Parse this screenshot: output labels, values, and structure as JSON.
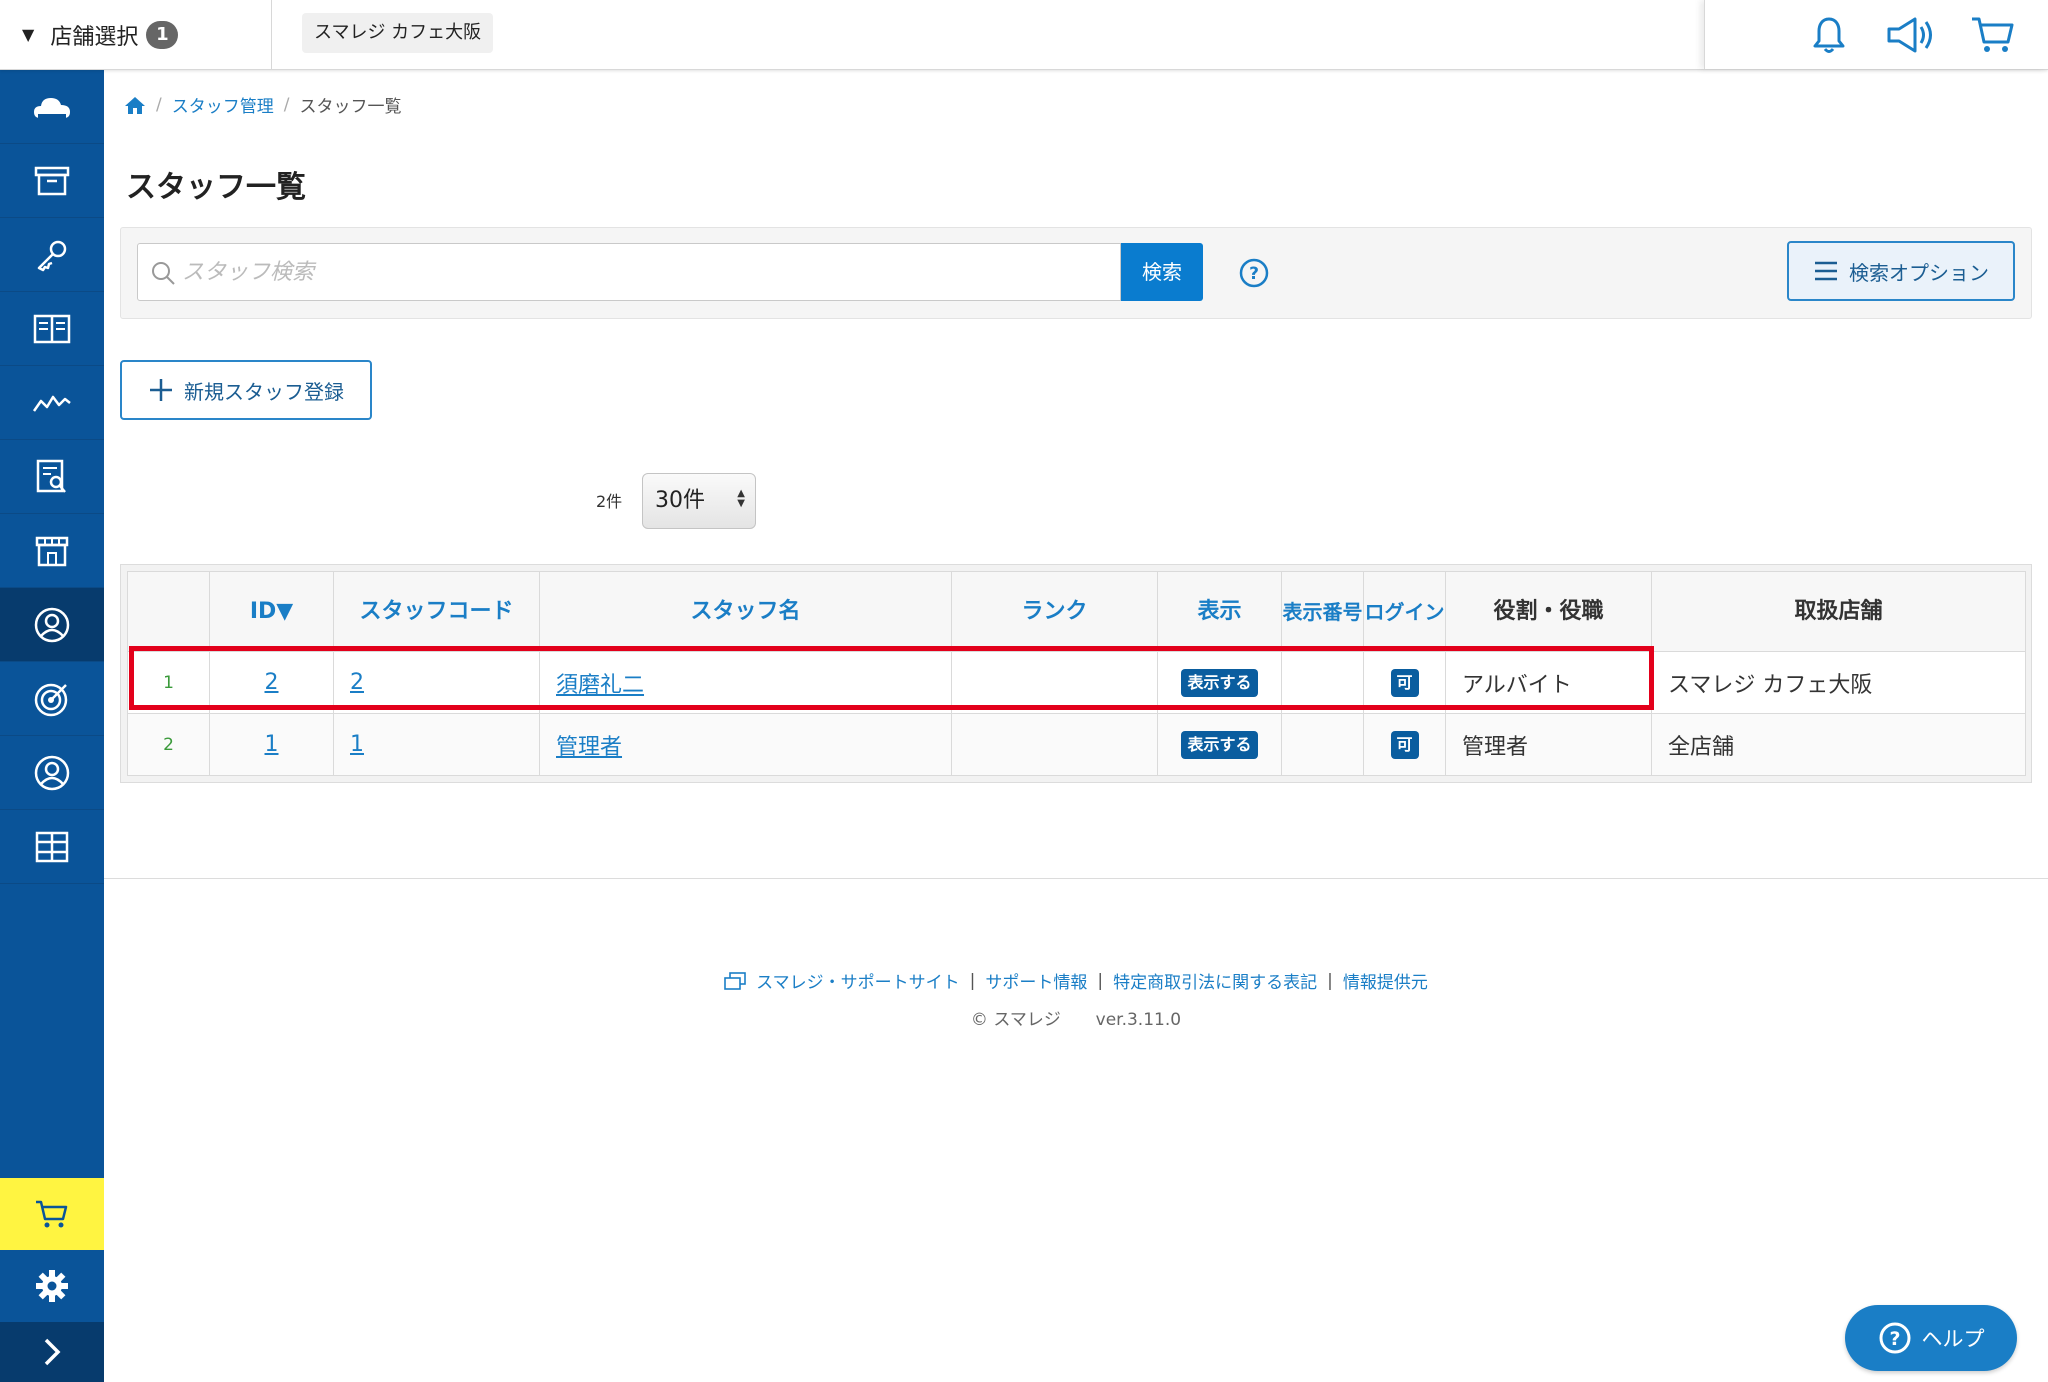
{
  "topbar": {
    "store_select_label": "店舗選択",
    "store_count": "1",
    "current_store": "スマレジ カフェ大阪"
  },
  "breadcrumb": {
    "level1": "スタッフ管理",
    "current": "スタッフ一覧"
  },
  "page_title": "スタッフ一覧",
  "search": {
    "placeholder": "スタッフ検索",
    "value": "",
    "button": "検索",
    "options_button": "検索オプション"
  },
  "new_button": "新規スタッフ登録",
  "pagination": {
    "count": "2件",
    "per_page": "30件"
  },
  "table": {
    "headers": [
      "",
      "ID▼",
      "スタッフコード",
      "スタッフ名",
      "ランク",
      "表示",
      "表示番号",
      "ログイン",
      "役割・役職",
      "取扱店舗"
    ],
    "rows": [
      {
        "no": "1",
        "id": "2",
        "code": "2",
        "name": "須磨礼二",
        "rank": "",
        "display": "表示する",
        "display_no": "",
        "login": "可",
        "role": "アルバイト",
        "store": "スマレジ カフェ大阪"
      },
      {
        "no": "2",
        "id": "1",
        "code": "1",
        "name": "管理者",
        "rank": "",
        "display": "表示する",
        "display_no": "",
        "login": "可",
        "role": "管理者",
        "store": "全店舗"
      }
    ]
  },
  "footer": {
    "links": [
      "スマレジ・サポートサイト",
      "サポート情報",
      "特定商取引法に関する表記",
      "情報提供元"
    ],
    "copyright": "© スマレジ",
    "version": "ver.3.11.0"
  },
  "help_button": "ヘルプ",
  "colors": {
    "sidebar": "#0a5499",
    "accent": "#1a7ec6",
    "highlight": "#e3001b",
    "cart_button": "#fff441"
  }
}
